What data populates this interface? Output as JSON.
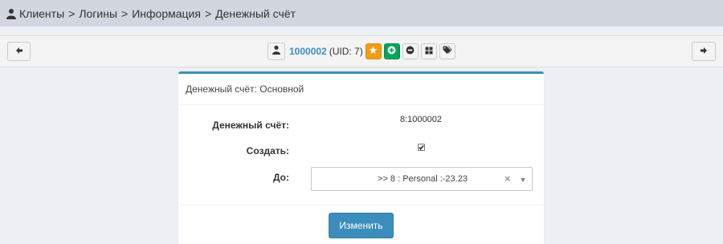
{
  "breadcrumb": {
    "icon": "user-icon",
    "items": [
      "Клиенты",
      "Логины",
      "Информация",
      "Денежный счёт"
    ],
    "separator": ">"
  },
  "toolbar": {
    "login_link": "1000002",
    "uid_text": "(UID: 7)",
    "buttons": [
      "user-icon",
      "star-icon",
      "plus-circle-icon",
      "minus-circle-icon",
      "grid-icon",
      "tags-icon"
    ],
    "nav": [
      "arrow-left-icon",
      "arrow-right-icon"
    ],
    "colors": {
      "star": "#f39c12",
      "plus": "#00a65a",
      "link": "#3c8dbc"
    }
  },
  "panel": {
    "title": "Денежный счёт: Основной",
    "fields": [
      {
        "label": "Денежный счёт:",
        "value": "8:1000002"
      },
      {
        "label": "Создать:",
        "checked": true
      },
      {
        "label": "До:",
        "value": ">> 8 : Personal :-23.23",
        "clear": "×"
      }
    ],
    "submit_label": "Изменить",
    "accent": "#3c8dbc"
  }
}
